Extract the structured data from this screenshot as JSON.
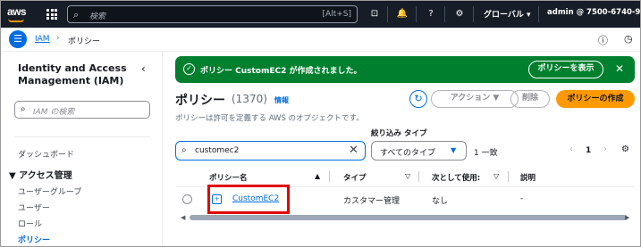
{
  "topbar": {
    "logo": "aws",
    "search_placeholder": "検索",
    "search_shortcut": "[Alt+S]",
    "region": "グローバル ▾",
    "account": "admin @ 7500-6740-9009 ▾",
    "icons": [
      "services-grid-icon",
      "search-icon",
      "cloudshell-icon",
      "bell-icon",
      "help-icon",
      "gear-icon"
    ]
  },
  "subbar": {
    "breadcrumb": [
      "IAM",
      "ポリシー"
    ],
    "icons": [
      "info-icon",
      "clock-icon"
    ]
  },
  "sidebar": {
    "title": "Identity and Access Management (IAM)",
    "search_placeholder": "IAM の検索",
    "items": [
      {
        "label": "ダッシュボード"
      },
      {
        "label": "▼ アクセス管理",
        "section": true
      },
      {
        "label": "ユーザーグループ"
      },
      {
        "label": "ユーザー"
      },
      {
        "label": "ロール"
      },
      {
        "label": "ポリシー",
        "active": true
      }
    ]
  },
  "banner": {
    "message": "ポリシー CustomEC2 が作成されました。",
    "view_button": "ポリシーを表示",
    "color": "#00802f"
  },
  "header": {
    "title": "ポリシー",
    "count": "(1370)",
    "info": "情報",
    "description": "ポリシーは許可を定義する AWS のオブジェクトです。",
    "action_button": "アクション ▼",
    "delete_button": "削除",
    "create_button": "ポリシーの作成"
  },
  "filter": {
    "label": "絞り込み タイプ",
    "search_value": "customec2",
    "type_value": "すべてのタイプ",
    "match_count": "1 一致",
    "page": "1"
  },
  "table": {
    "columns": [
      "ポリシー名",
      "タイプ",
      "次として使用:",
      "説明"
    ],
    "rows": [
      {
        "name": "CustomEC2",
        "type": "カスタマー管理",
        "used_as": "なし",
        "description": "-"
      }
    ]
  },
  "colors": {
    "accent": "#006ce0",
    "primary": "#ff9900",
    "highlight": "#e00000"
  }
}
